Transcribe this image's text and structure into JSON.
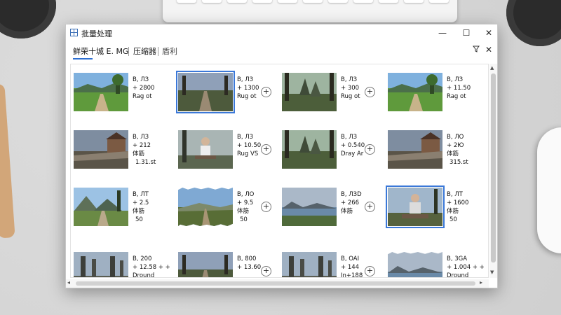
{
  "window": {
    "title": "批量处理",
    "minimize_glyph": "—",
    "maximize_glyph": "☐",
    "close_glyph": "✕"
  },
  "toolbar": {
    "tabs": [
      "鲜荣十城 E. MG",
      "压缩器",
      "盾利"
    ],
    "filter_icon": "filter-icon",
    "close_glyph": "✕"
  },
  "tiles": [
    {
      "l1": "B, ЛЗ",
      "l2": "+ 2800",
      "l3": "Rag ot",
      "plus": false,
      "scene": "meadow",
      "sel": false,
      "torn": false
    },
    {
      "l1": "B, ЛЗ",
      "l2": "+ 1300",
      "l3": "Rug ot",
      "plus": true,
      "scene": "path",
      "sel": true,
      "torn": false
    },
    {
      "l1": "B, ЛЗ",
      "l2": "+ 300",
      "l3": "Rug ot",
      "plus": true,
      "scene": "forest",
      "sel": false,
      "torn": false
    },
    {
      "l1": "B, ЛЗ",
      "l2": "+ 11.50",
      "l3": "Rag ot",
      "plus": false,
      "scene": "meadow",
      "sel": false,
      "torn": false
    },
    {
      "l1": "B, ЛЗ",
      "l2": "+ 212",
      "l3": "体筋",
      "suffix": "1.31.st",
      "plus": false,
      "scene": "house",
      "sel": false,
      "torn": false
    },
    {
      "l1": "B, ЛЗ",
      "l2": "+ 10.50",
      "l3": "Rug VS",
      "plus": true,
      "scene": "woman",
      "sel": false,
      "torn": false
    },
    {
      "l1": "B, ЛЗ",
      "l2": "+ 0.540",
      "l3": "Dray Ar",
      "plus": true,
      "scene": "forest",
      "sel": false,
      "torn": false
    },
    {
      "l1": "B, ЛO",
      "l2": "+ 2Ю",
      "l3": "体筋",
      "suffix": "315.st",
      "plus": false,
      "scene": "house",
      "sel": false,
      "torn": false
    },
    {
      "l1": "B, ЛT",
      "l2": "+ 2.5",
      "l3": "体筋",
      "suffix": "50",
      "plus": false,
      "scene": "mountain",
      "sel": false,
      "torn": false
    },
    {
      "l1": "B, ЛO",
      "l2": "+ 9.5",
      "l3": "体筋",
      "suffix": "50",
      "plus": true,
      "scene": "field",
      "sel": false,
      "torn": true
    },
    {
      "l1": "B, ЛЗD",
      "l2": "+ 266",
      "l3": "体筋",
      "plus": true,
      "scene": "lake",
      "sel": false,
      "torn": false
    },
    {
      "l1": "B, ЛT",
      "l2": "+ 1600",
      "l3": "体筋",
      "suffix": "50",
      "plus": false,
      "scene": "man",
      "sel": true,
      "torn": false
    },
    {
      "l1": "B, 200",
      "l2": "+ 12.58 + +",
      "l3": "Dround",
      "plus": false,
      "scene": "pillars",
      "sel": false,
      "torn": false
    },
    {
      "l1": "B, 800",
      "l2": "+ 13.60",
      "l3": "",
      "plus": true,
      "scene": "path",
      "sel": false,
      "torn": false
    },
    {
      "l1": "B, OAI",
      "l2": "+ 144",
      "l3": "Jn+188",
      "plus": true,
      "scene": "pillars",
      "sel": false,
      "torn": false
    },
    {
      "l1": "B, 3GA",
      "l2": "+ 1.004 + +",
      "l3": "Dround",
      "plus": false,
      "scene": "lake",
      "sel": false,
      "torn": true
    }
  ]
}
